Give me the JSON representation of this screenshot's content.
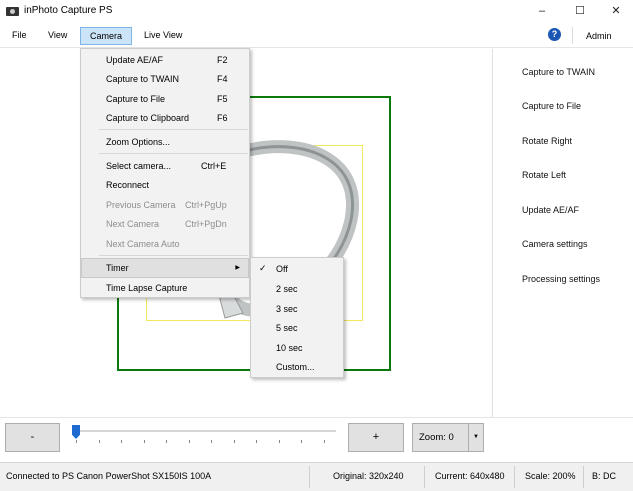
{
  "window": {
    "title": "inPhoto Capture PS",
    "controls": [
      "–",
      "☐",
      "✕"
    ]
  },
  "menubar": {
    "items": [
      "File",
      "View",
      "Camera",
      "Live View"
    ],
    "admin": "Admin",
    "help": "?"
  },
  "camera_menu": {
    "items": [
      {
        "label": "Update AE/AF",
        "shortcut": "F2",
        "disabled": false
      },
      {
        "label": "Capture to TWAIN",
        "shortcut": "F4",
        "disabled": false
      },
      {
        "label": "Capture to File",
        "shortcut": "F5",
        "disabled": false
      },
      {
        "label": "Capture to Clipboard",
        "shortcut": "F6",
        "disabled": false
      },
      {
        "label": "Zoom Options...",
        "shortcut": "",
        "disabled": false
      },
      {
        "label": "Select camera...",
        "shortcut": "Ctrl+E",
        "disabled": false
      },
      {
        "label": "Reconnect",
        "shortcut": "",
        "disabled": false
      },
      {
        "label": "Previous Camera",
        "shortcut": "Ctrl+PgUp",
        "disabled": true
      },
      {
        "label": "Next Camera",
        "shortcut": "Ctrl+PgDn",
        "disabled": true
      },
      {
        "label": "Next Camera Auto",
        "shortcut": "",
        "disabled": true
      },
      {
        "label": "Timer",
        "shortcut": "",
        "disabled": false
      },
      {
        "label": "Time Lapse Capture",
        "shortcut": "",
        "disabled": false
      }
    ]
  },
  "timer_menu": {
    "items": [
      "Off",
      "2 sec",
      "3 sec",
      "5 sec",
      "10 sec",
      "Custom..."
    ],
    "selected": "Off"
  },
  "sidebar": {
    "buttons": [
      "Capture to TWAIN",
      "Capture to File",
      "Rotate Right",
      "Rotate Left",
      "Update AE/AF",
      "Camera settings",
      "Processing settings"
    ]
  },
  "bottom": {
    "minus": "-",
    "plus": "+",
    "zoom_label": "Zoom: 0",
    "zoom_level": 0
  },
  "status": {
    "connection": "Connected to PS Canon PowerShot SX150IS 100A",
    "original": "Original: 320x240",
    "current": "Current: 640x480",
    "scale": "Scale: 200%",
    "misc": "B: DC"
  },
  "colors": {
    "accent": "#1f6ad0",
    "frame_green": "#0b7a0b",
    "frame_yellow": "#f2e85a",
    "help": "#1a57b5"
  }
}
